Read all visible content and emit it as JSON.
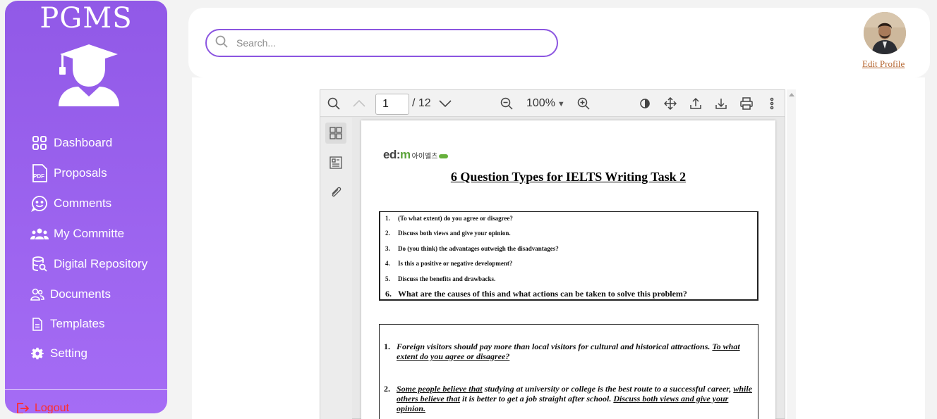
{
  "brand": "PGMS",
  "sidebar": {
    "items": [
      {
        "label": "Dashboard",
        "icon": "dashboard-grid-icon"
      },
      {
        "label": "Proposals",
        "icon": "pdf-file-icon"
      },
      {
        "label": "Comments",
        "icon": "smiley-chat-icon"
      },
      {
        "label": "My Committe",
        "icon": "users-group-icon"
      },
      {
        "label": "Digital Repository",
        "icon": "database-search-icon"
      },
      {
        "label": "Documents",
        "icon": "users-icon"
      },
      {
        "label": "Templates",
        "icon": "document-icon"
      },
      {
        "label": "Setting",
        "icon": "gear-icon"
      }
    ],
    "logout_label": "Logout",
    "colors": {
      "gradient_top": "#9159e7",
      "gradient_bottom": "#a56cf5",
      "logout": "#ff2d2d"
    }
  },
  "header": {
    "search_placeholder": "Search...",
    "edit_profile_label": "Edit Profile"
  },
  "viewer": {
    "current_page": "1",
    "total_pages": "/ 12",
    "zoom": "100%"
  },
  "document": {
    "brand_en_prefix": "ed:",
    "brand_en_m": "m",
    "brand_kr": "아이엘츠",
    "title": "6 Question Types for IELTS Writing Task 2",
    "questions": [
      {
        "n": "1.",
        "text": "(To what extent) do you agree or disagree?"
      },
      {
        "n": "2.",
        "text": "Discuss both views and give your opinion."
      },
      {
        "n": "3.",
        "text": "Do (you think) the advantages outweigh the disadvantages?"
      },
      {
        "n": "4.",
        "text": "Is this a positive or negative development?"
      },
      {
        "n": "5.",
        "text": "Discuss the benefits and drawbacks."
      },
      {
        "n": "6.",
        "text": "What are the causes of this and what actions can be taken to solve this problem?"
      }
    ],
    "examples": [
      {
        "n": "1.",
        "part1": "Foreign visitors should pay more than local visitors for cultural and historical attractions. ",
        "part2": "To what extent do you agree or disagree?"
      },
      {
        "n": "2.",
        "part1": "Some people believe that",
        "part2": " studying at university or college is the best route to a successful career, ",
        "part3": "while others believe that",
        "part4": " it is better to get a job straight after school. ",
        "part5": "Discuss both views and give your opinion."
      }
    ]
  }
}
